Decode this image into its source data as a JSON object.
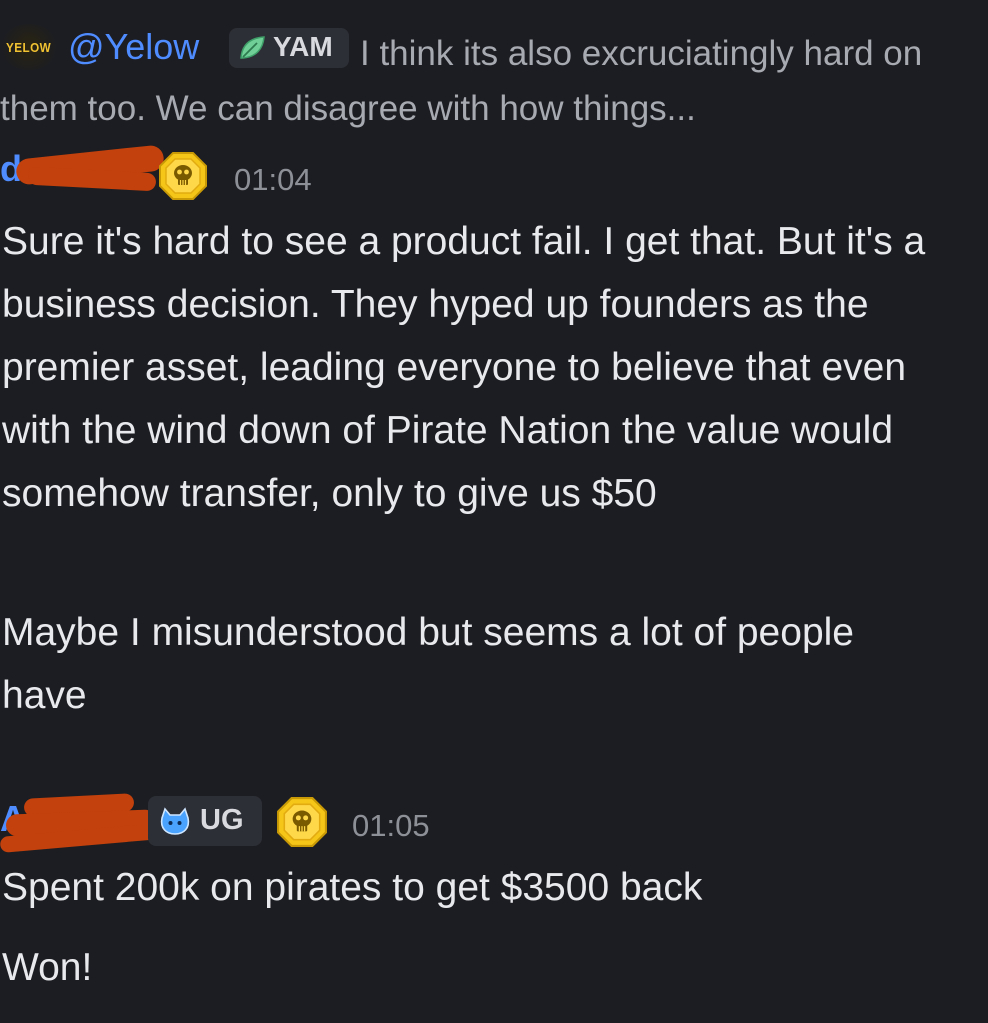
{
  "reply": {
    "avatar_text": "YELOW",
    "mention": "@Yelow",
    "tag_icon": "leaf-icon",
    "tag": "YAM",
    "text": "I think its also excruciatingly hard on them too. We can disagree with how things..."
  },
  "messages": [
    {
      "badge_icon": "skull-coin-icon",
      "timestamp": "01:04",
      "paragraphs": [
        "Sure it's hard to see a product fail. I get that. But it's a business decision. They hyped up founders as the premier asset, leading everyone to believe that even with the wind down of Pirate Nation the value would somehow transfer, only to give us $50",
        "Maybe I misunderstood but seems a lot of people have"
      ]
    },
    {
      "role_tag_icon": "blue-cat-icon",
      "role_tag": "UG",
      "badge_icon": "skull-coin-icon",
      "timestamp": "01:05",
      "paragraphs": [
        "Spent 200k on pirates to get $3500 back",
        "Won!"
      ]
    }
  ],
  "colors": {
    "background": "#1c1d22",
    "username": "#4f8cff",
    "redaction": "#c2410c",
    "badge_gold": "#f5c518"
  }
}
